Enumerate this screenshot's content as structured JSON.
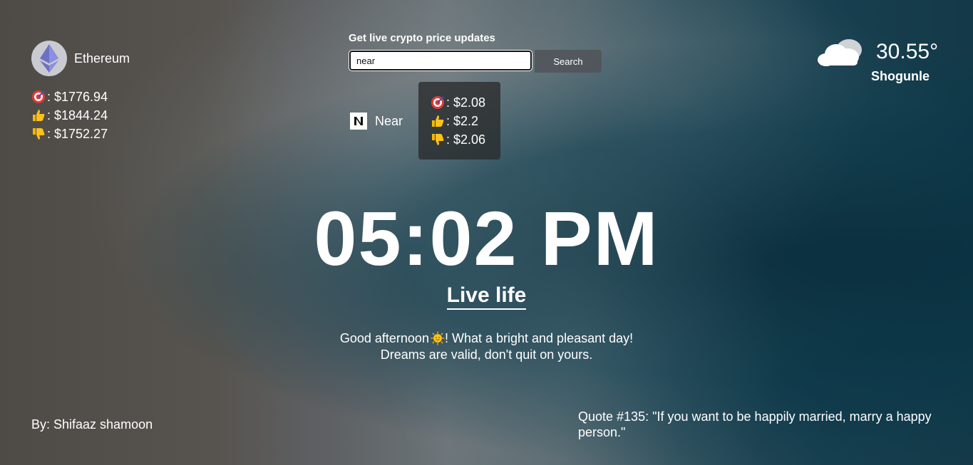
{
  "crypto_left": {
    "name": "Ethereum",
    "logo_icon": "ethereum-logo-icon",
    "prices": [
      {
        "icon": "target-icon",
        "label": ": $1776.94"
      },
      {
        "icon": "thumbs-up-icon",
        "label": ": $1844.24"
      },
      {
        "icon": "thumbs-down-icon",
        "label": ": $1752.27"
      }
    ]
  },
  "search": {
    "title": "Get live crypto price updates",
    "input_value": "near",
    "button_label": "Search"
  },
  "result": {
    "name": "Near",
    "logo_icon": "near-logo-icon",
    "prices": [
      {
        "icon": "target-icon",
        "label": ": $2.08"
      },
      {
        "icon": "thumbs-up-icon",
        "label": ": $2.2"
      },
      {
        "icon": "thumbs-down-icon",
        "label": ": $2.06"
      }
    ]
  },
  "weather": {
    "icon": "cloud-icon",
    "temperature": "30.55°",
    "location": "Shogunle"
  },
  "clock": {
    "time": "05:02 PM"
  },
  "heading": "Live life",
  "greeting": {
    "line1_pre": "Good afternoon",
    "sun_icon": "sun-icon",
    "line1_post": "! What a bright and pleasant day!",
    "line2": "Dreams are valid, don't quit on yours."
  },
  "footer": {
    "author": "By: Shifaaz shamoon",
    "quote": "Quote #135: \"If you want to be happily married, marry a happy person.\""
  }
}
